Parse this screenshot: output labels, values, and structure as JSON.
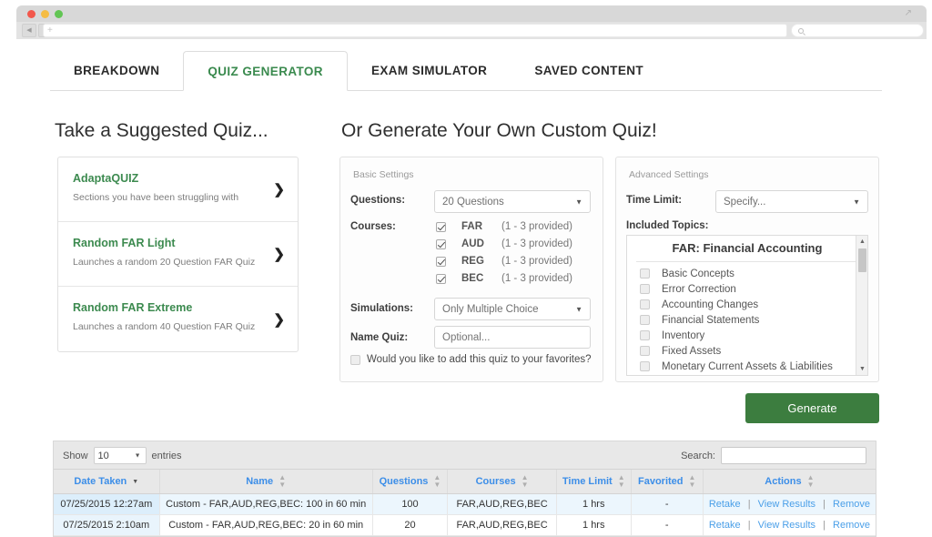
{
  "browser": {
    "back_icon": "back-arrow-icon",
    "forward_icon": "forward-arrow-icon",
    "new_tab_label": "+",
    "url_value": "",
    "search_placeholder": "",
    "search_icon": "magnifier-icon",
    "expand_icon": "expand-icon"
  },
  "tabs": [
    {
      "label": "BREAKDOWN",
      "active": false
    },
    {
      "label": "QUIZ GENERATOR",
      "active": true
    },
    {
      "label": "EXAM SIMULATOR",
      "active": false
    },
    {
      "label": "SAVED CONTENT",
      "active": false
    }
  ],
  "headings": {
    "left": "Take a Suggested Quiz...",
    "right": "Or Generate Your Own Custom Quiz!"
  },
  "suggested": [
    {
      "title": "AdaptaQUIZ",
      "subtitle": "Sections you have been struggling with",
      "chevron": "chevron-right-icon"
    },
    {
      "title": "Random FAR Light",
      "subtitle": "Launches a random 20 Question FAR Quiz",
      "chevron": "chevron-right-icon"
    },
    {
      "title": "Random FAR Extreme",
      "subtitle": "Launches a random 40 Question FAR Quiz",
      "chevron": "chevron-right-icon"
    }
  ],
  "basic_settings": {
    "legend": "Basic Settings",
    "questions_label": "Questions:",
    "questions_value": "20 Questions",
    "courses_label": "Courses:",
    "courses": [
      {
        "code": "FAR",
        "note": "(1 - 3 provided)",
        "checked": true
      },
      {
        "code": "AUD",
        "note": "(1 - 3 provided)",
        "checked": true
      },
      {
        "code": "REG",
        "note": "(1 - 3 provided)",
        "checked": true
      },
      {
        "code": "BEC",
        "note": "(1 - 3 provided)",
        "checked": true
      }
    ],
    "simulations_label": "Simulations:",
    "simulations_value": "Only Multiple Choice",
    "name_quiz_label": "Name Quiz:",
    "name_quiz_placeholder": "Optional...",
    "name_quiz_value": "",
    "favorite_label": "Would you like to add this quiz to your favorites?",
    "favorite_checked": false
  },
  "advanced_settings": {
    "legend": "Advanced Settings",
    "time_limit_label": "Time Limit:",
    "time_limit_value": "Specify...",
    "included_topics_label": "Included Topics:",
    "topics_title": "FAR: Financial Accounting",
    "topics": [
      {
        "label": "Basic Concepts",
        "checked": false
      },
      {
        "label": "Error Correction",
        "checked": false
      },
      {
        "label": "Accounting Changes",
        "checked": false
      },
      {
        "label": "Financial Statements",
        "checked": false
      },
      {
        "label": "Inventory",
        "checked": false
      },
      {
        "label": "Fixed Assets",
        "checked": false
      },
      {
        "label": "Monetary Current Assets & Liabilities",
        "checked": false
      }
    ],
    "scroll_up_icon": "scroll-up-arrow-icon",
    "scroll_down_icon": "scroll-down-arrow-icon"
  },
  "generate_button": "Generate",
  "accent_colors": {
    "brand_green": "#3c8a4f",
    "button_green": "#3c7d3f",
    "link_blue": "#4a9fe8",
    "header_blue": "#3c8ee8",
    "row_highlight": "#ecf6fd"
  },
  "table": {
    "show_label": "Show",
    "entries_label": "entries",
    "page_size": "10",
    "search_label": "Search:",
    "search_value": "",
    "columns": [
      {
        "label": "Date Taken",
        "sort": "desc"
      },
      {
        "label": "Name",
        "sort": "none"
      },
      {
        "label": "Questions",
        "sort": "none"
      },
      {
        "label": "Courses",
        "sort": "none"
      },
      {
        "label": "Time Limit",
        "sort": "none"
      },
      {
        "label": "Favorited",
        "sort": "none"
      },
      {
        "label": "Actions",
        "sort": "none"
      }
    ],
    "actions": {
      "retake": "Retake",
      "view_results": "View Results",
      "remove": "Remove",
      "separator": "|"
    },
    "rows": [
      {
        "date": "07/25/2015 12:27am",
        "name": "Custom - FAR,AUD,REG,BEC: 100 in 60 min",
        "questions": "100",
        "courses": "FAR,AUD,REG,BEC",
        "time_limit": "1 hrs",
        "favorited": "-"
      },
      {
        "date": "07/25/2015 2:10am",
        "name": "Custom - FAR,AUD,REG,BEC: 20 in 60 min",
        "questions": "20",
        "courses": "FAR,AUD,REG,BEC",
        "time_limit": "1 hrs",
        "favorited": "-"
      }
    ]
  }
}
